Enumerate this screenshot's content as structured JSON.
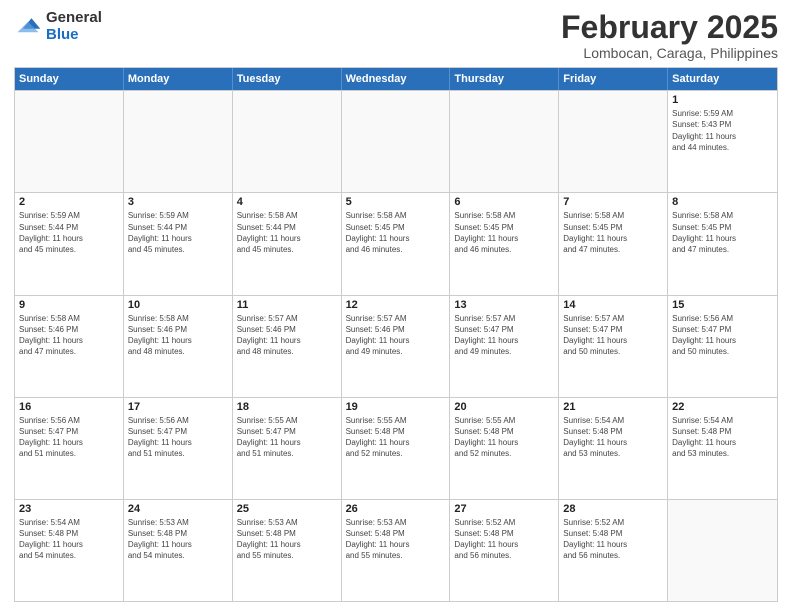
{
  "header": {
    "logo_general": "General",
    "logo_blue": "Blue",
    "month_title": "February 2025",
    "location": "Lombocan, Caraga, Philippines"
  },
  "calendar": {
    "days_of_week": [
      "Sunday",
      "Monday",
      "Tuesday",
      "Wednesday",
      "Thursday",
      "Friday",
      "Saturday"
    ],
    "rows": [
      [
        {
          "day": "",
          "info": ""
        },
        {
          "day": "",
          "info": ""
        },
        {
          "day": "",
          "info": ""
        },
        {
          "day": "",
          "info": ""
        },
        {
          "day": "",
          "info": ""
        },
        {
          "day": "",
          "info": ""
        },
        {
          "day": "1",
          "info": "Sunrise: 5:59 AM\nSunset: 5:43 PM\nDaylight: 11 hours\nand 44 minutes."
        }
      ],
      [
        {
          "day": "2",
          "info": "Sunrise: 5:59 AM\nSunset: 5:44 PM\nDaylight: 11 hours\nand 45 minutes."
        },
        {
          "day": "3",
          "info": "Sunrise: 5:59 AM\nSunset: 5:44 PM\nDaylight: 11 hours\nand 45 minutes."
        },
        {
          "day": "4",
          "info": "Sunrise: 5:58 AM\nSunset: 5:44 PM\nDaylight: 11 hours\nand 45 minutes."
        },
        {
          "day": "5",
          "info": "Sunrise: 5:58 AM\nSunset: 5:45 PM\nDaylight: 11 hours\nand 46 minutes."
        },
        {
          "day": "6",
          "info": "Sunrise: 5:58 AM\nSunset: 5:45 PM\nDaylight: 11 hours\nand 46 minutes."
        },
        {
          "day": "7",
          "info": "Sunrise: 5:58 AM\nSunset: 5:45 PM\nDaylight: 11 hours\nand 47 minutes."
        },
        {
          "day": "8",
          "info": "Sunrise: 5:58 AM\nSunset: 5:45 PM\nDaylight: 11 hours\nand 47 minutes."
        }
      ],
      [
        {
          "day": "9",
          "info": "Sunrise: 5:58 AM\nSunset: 5:46 PM\nDaylight: 11 hours\nand 47 minutes."
        },
        {
          "day": "10",
          "info": "Sunrise: 5:58 AM\nSunset: 5:46 PM\nDaylight: 11 hours\nand 48 minutes."
        },
        {
          "day": "11",
          "info": "Sunrise: 5:57 AM\nSunset: 5:46 PM\nDaylight: 11 hours\nand 48 minutes."
        },
        {
          "day": "12",
          "info": "Sunrise: 5:57 AM\nSunset: 5:46 PM\nDaylight: 11 hours\nand 49 minutes."
        },
        {
          "day": "13",
          "info": "Sunrise: 5:57 AM\nSunset: 5:47 PM\nDaylight: 11 hours\nand 49 minutes."
        },
        {
          "day": "14",
          "info": "Sunrise: 5:57 AM\nSunset: 5:47 PM\nDaylight: 11 hours\nand 50 minutes."
        },
        {
          "day": "15",
          "info": "Sunrise: 5:56 AM\nSunset: 5:47 PM\nDaylight: 11 hours\nand 50 minutes."
        }
      ],
      [
        {
          "day": "16",
          "info": "Sunrise: 5:56 AM\nSunset: 5:47 PM\nDaylight: 11 hours\nand 51 minutes."
        },
        {
          "day": "17",
          "info": "Sunrise: 5:56 AM\nSunset: 5:47 PM\nDaylight: 11 hours\nand 51 minutes."
        },
        {
          "day": "18",
          "info": "Sunrise: 5:55 AM\nSunset: 5:47 PM\nDaylight: 11 hours\nand 51 minutes."
        },
        {
          "day": "19",
          "info": "Sunrise: 5:55 AM\nSunset: 5:48 PM\nDaylight: 11 hours\nand 52 minutes."
        },
        {
          "day": "20",
          "info": "Sunrise: 5:55 AM\nSunset: 5:48 PM\nDaylight: 11 hours\nand 52 minutes."
        },
        {
          "day": "21",
          "info": "Sunrise: 5:54 AM\nSunset: 5:48 PM\nDaylight: 11 hours\nand 53 minutes."
        },
        {
          "day": "22",
          "info": "Sunrise: 5:54 AM\nSunset: 5:48 PM\nDaylight: 11 hours\nand 53 minutes."
        }
      ],
      [
        {
          "day": "23",
          "info": "Sunrise: 5:54 AM\nSunset: 5:48 PM\nDaylight: 11 hours\nand 54 minutes."
        },
        {
          "day": "24",
          "info": "Sunrise: 5:53 AM\nSunset: 5:48 PM\nDaylight: 11 hours\nand 54 minutes."
        },
        {
          "day": "25",
          "info": "Sunrise: 5:53 AM\nSunset: 5:48 PM\nDaylight: 11 hours\nand 55 minutes."
        },
        {
          "day": "26",
          "info": "Sunrise: 5:53 AM\nSunset: 5:48 PM\nDaylight: 11 hours\nand 55 minutes."
        },
        {
          "day": "27",
          "info": "Sunrise: 5:52 AM\nSunset: 5:48 PM\nDaylight: 11 hours\nand 56 minutes."
        },
        {
          "day": "28",
          "info": "Sunrise: 5:52 AM\nSunset: 5:48 PM\nDaylight: 11 hours\nand 56 minutes."
        },
        {
          "day": "",
          "info": ""
        }
      ]
    ]
  }
}
